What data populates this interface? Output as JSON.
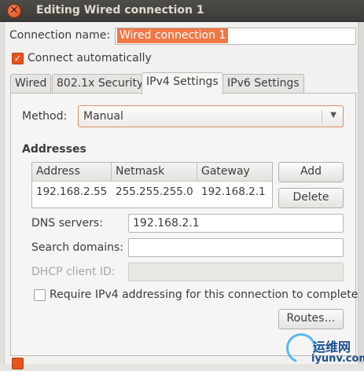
{
  "window": {
    "title": "Editing Wired connection 1",
    "close_icon": "close-icon",
    "close_glyph": "✕"
  },
  "connection": {
    "name_label": "Connection name:",
    "name_value": "Wired connection 1",
    "auto_label": "Connect automatically",
    "auto_checked": true,
    "check_glyph": "✓"
  },
  "tabs": [
    {
      "label": "Wired",
      "active": false
    },
    {
      "label": "802.1x Security",
      "active": false
    },
    {
      "label": "IPv4 Settings",
      "active": true
    },
    {
      "label": "IPv6 Settings",
      "active": false
    }
  ],
  "ipv4": {
    "method_label": "Method:",
    "method_value": "Manual",
    "method_arrow": "▼",
    "addresses_heading": "Addresses",
    "addresses": {
      "columns": [
        "Address",
        "Netmask",
        "Gateway"
      ],
      "rows": [
        [
          "192.168.2.55",
          "255.255.255.0",
          "192.168.2.1"
        ]
      ]
    },
    "add_label": "Add",
    "delete_label": "Delete",
    "dns_label": "DNS servers:",
    "dns_value": "192.168.2.1",
    "search_label": "Search domains:",
    "search_value": "",
    "dhcp_label": "DHCP client ID:",
    "dhcp_value": "",
    "require_label": "Require IPv4 addressing for this connection to complete",
    "require_checked": false,
    "routes_label": "Routes…"
  },
  "watermark": {
    "cn": "运维网",
    "url": "iyunv.com"
  },
  "colors": {
    "accent": "#e9531d",
    "selection": "#f07746",
    "titlebar": "#3c3b37"
  }
}
